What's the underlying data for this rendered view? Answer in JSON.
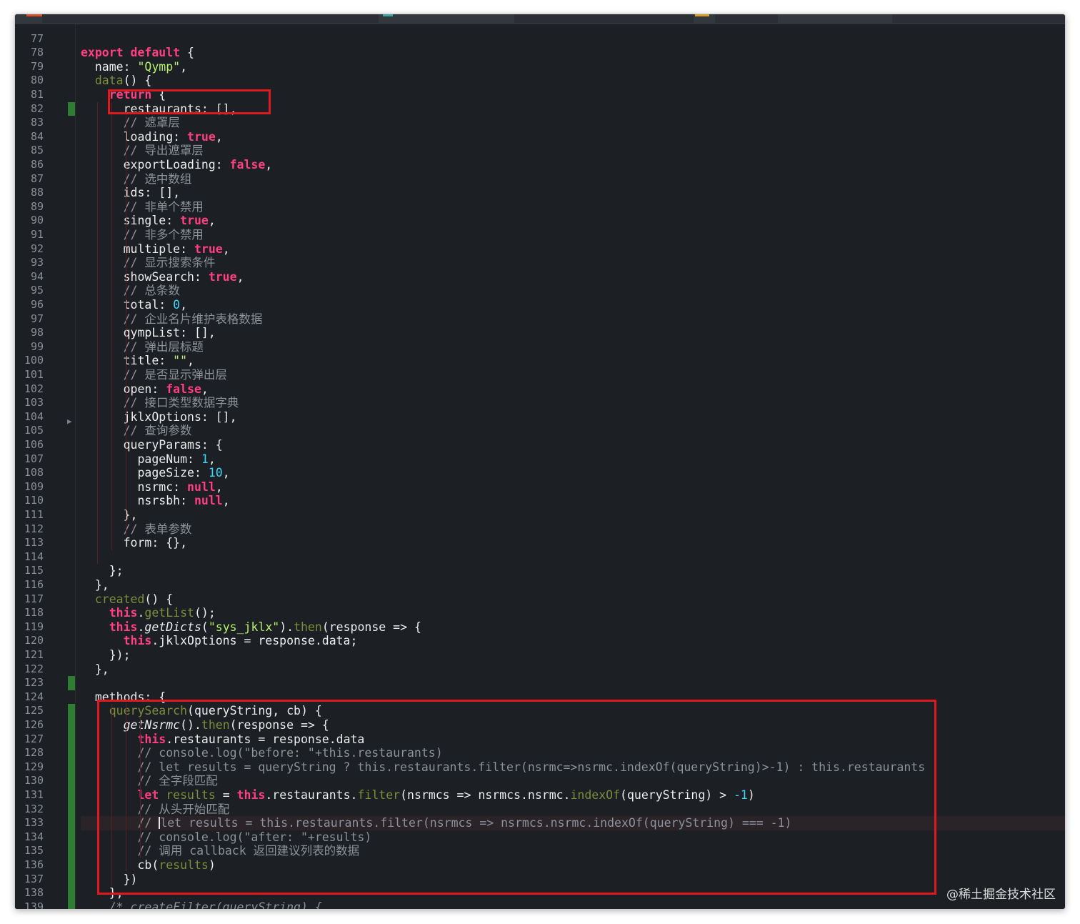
{
  "editor": {
    "line_numbers": [
      "77",
      "78",
      "79",
      "80",
      "81",
      "82",
      "83",
      "84",
      "85",
      "86",
      "87",
      "88",
      "89",
      "90",
      "91",
      "92",
      "93",
      "94",
      "95",
      "96",
      "97",
      "98",
      "99",
      "100",
      "101",
      "102",
      "103",
      "104",
      "105",
      "106",
      "107",
      "108",
      "109",
      "110",
      "111",
      "112",
      "113",
      "114",
      "115",
      "116",
      "117",
      "118",
      "119",
      "120",
      "121",
      "122",
      "123",
      "124",
      "125",
      "126",
      "127",
      "128",
      "129",
      "130",
      "131",
      "132",
      "133",
      "134",
      "135",
      "136",
      "137",
      "138",
      "139"
    ],
    "cursor_line": "133",
    "lines": [
      [],
      [
        {
          "t": "kw",
          "v": "export default"
        },
        {
          "t": "id",
          "v": " {"
        }
      ],
      [
        {
          "t": "id",
          "v": "  name: "
        },
        {
          "t": "str",
          "v": "\"Qymp\""
        },
        {
          "t": "id",
          "v": ","
        }
      ],
      [
        {
          "t": "fn",
          "v": "  data"
        },
        {
          "t": "id",
          "v": "() {"
        }
      ],
      [
        {
          "t": "kw",
          "v": "    return"
        },
        {
          "t": "id",
          "v": " {"
        }
      ],
      [
        {
          "t": "id",
          "v": "      restaurants: [],"
        }
      ],
      [
        {
          "t": "cmt",
          "v": "      // 遮罩层"
        }
      ],
      [
        {
          "t": "id",
          "v": "      loading: "
        },
        {
          "t": "kw",
          "v": "true"
        },
        {
          "t": "id",
          "v": ","
        }
      ],
      [
        {
          "t": "cmt",
          "v": "      // 导出遮罩层"
        }
      ],
      [
        {
          "t": "id",
          "v": "      exportLoading: "
        },
        {
          "t": "kw",
          "v": "false"
        },
        {
          "t": "id",
          "v": ","
        }
      ],
      [
        {
          "t": "cmt",
          "v": "      // 选中数组"
        }
      ],
      [
        {
          "t": "id",
          "v": "      ids: [],"
        }
      ],
      [
        {
          "t": "cmt",
          "v": "      // 非单个禁用"
        }
      ],
      [
        {
          "t": "id",
          "v": "      single: "
        },
        {
          "t": "kw",
          "v": "true"
        },
        {
          "t": "id",
          "v": ","
        }
      ],
      [
        {
          "t": "cmt",
          "v": "      // 非多个禁用"
        }
      ],
      [
        {
          "t": "id",
          "v": "      multiple: "
        },
        {
          "t": "kw",
          "v": "true"
        },
        {
          "t": "id",
          "v": ","
        }
      ],
      [
        {
          "t": "cmt",
          "v": "      // 显示搜索条件"
        }
      ],
      [
        {
          "t": "id",
          "v": "      showSearch: "
        },
        {
          "t": "kw",
          "v": "true"
        },
        {
          "t": "id",
          "v": ","
        }
      ],
      [
        {
          "t": "cmt",
          "v": "      // 总条数"
        }
      ],
      [
        {
          "t": "id",
          "v": "      total: "
        },
        {
          "t": "num",
          "v": "0"
        },
        {
          "t": "id",
          "v": ","
        }
      ],
      [
        {
          "t": "cmt",
          "v": "      // 企业名片维护表格数据"
        }
      ],
      [
        {
          "t": "id",
          "v": "      qympList: [],"
        }
      ],
      [
        {
          "t": "cmt",
          "v": "      // 弹出层标题"
        }
      ],
      [
        {
          "t": "id",
          "v": "      title: "
        },
        {
          "t": "str",
          "v": "\"\""
        },
        {
          "t": "id",
          "v": ","
        }
      ],
      [
        {
          "t": "cmt",
          "v": "      // 是否显示弹出层"
        }
      ],
      [
        {
          "t": "id",
          "v": "      open: "
        },
        {
          "t": "kw",
          "v": "false"
        },
        {
          "t": "id",
          "v": ","
        }
      ],
      [
        {
          "t": "cmt",
          "v": "      // 接口类型数据字典"
        }
      ],
      [
        {
          "t": "id",
          "v": "      jklxOptions: [],"
        }
      ],
      [
        {
          "t": "cmt",
          "v": "      // 查询参数"
        }
      ],
      [
        {
          "t": "id",
          "v": "      queryParams: {"
        }
      ],
      [
        {
          "t": "id",
          "v": "        pageNum: "
        },
        {
          "t": "num",
          "v": "1"
        },
        {
          "t": "id",
          "v": ","
        }
      ],
      [
        {
          "t": "id",
          "v": "        pageSize: "
        },
        {
          "t": "num",
          "v": "10"
        },
        {
          "t": "id",
          "v": ","
        }
      ],
      [
        {
          "t": "id",
          "v": "        nsrmc: "
        },
        {
          "t": "kw",
          "v": "null"
        },
        {
          "t": "id",
          "v": ","
        }
      ],
      [
        {
          "t": "id",
          "v": "        nsrsbh: "
        },
        {
          "t": "kw",
          "v": "null"
        },
        {
          "t": "id",
          "v": ","
        }
      ],
      [
        {
          "t": "id",
          "v": "      },"
        }
      ],
      [
        {
          "t": "cmt",
          "v": "      // 表单参数"
        }
      ],
      [
        {
          "t": "id",
          "v": "      form: {},"
        }
      ],
      [],
      [
        {
          "t": "id",
          "v": "    };"
        }
      ],
      [
        {
          "t": "id",
          "v": "  },"
        }
      ],
      [
        {
          "t": "fn",
          "v": "  created"
        },
        {
          "t": "id",
          "v": "() {"
        }
      ],
      [
        {
          "t": "kw",
          "v": "    this"
        },
        {
          "t": "id",
          "v": "."
        },
        {
          "t": "fn",
          "v": "getList"
        },
        {
          "t": "id",
          "v": "();"
        }
      ],
      [
        {
          "t": "kw",
          "v": "    this"
        },
        {
          "t": "id",
          "v": "."
        },
        {
          "t": "id it",
          "v": "getDicts"
        },
        {
          "t": "id",
          "v": "("
        },
        {
          "t": "str",
          "v": "\"sys_jklx\""
        },
        {
          "t": "id",
          "v": ")."
        },
        {
          "t": "fn",
          "v": "then"
        },
        {
          "t": "id",
          "v": "(response => {"
        }
      ],
      [
        {
          "t": "kw",
          "v": "      this"
        },
        {
          "t": "id",
          "v": ".jklxOptions = response.data;"
        }
      ],
      [
        {
          "t": "id",
          "v": "    });"
        }
      ],
      [
        {
          "t": "id",
          "v": "  },"
        }
      ],
      [],
      [
        {
          "t": "id",
          "v": "  methods: {"
        }
      ],
      [
        {
          "t": "fn",
          "v": "    querySearch"
        },
        {
          "t": "id",
          "v": "(queryString, cb) {"
        }
      ],
      [
        {
          "t": "id it",
          "v": "      getNsrmc"
        },
        {
          "t": "id",
          "v": "()."
        },
        {
          "t": "fn",
          "v": "then"
        },
        {
          "t": "id",
          "v": "(response => {"
        }
      ],
      [
        {
          "t": "kw",
          "v": "        this"
        },
        {
          "t": "id",
          "v": ".restaurants = response.data"
        }
      ],
      [
        {
          "t": "cmt",
          "v": "        // console.log(\"before: \"+this.restaurants)"
        }
      ],
      [
        {
          "t": "cmt",
          "v": "        // let results = queryString ? this.restaurants.filter(nsrmc=>nsrmc.indexOf(queryString)>-1) : this.restaurants"
        }
      ],
      [
        {
          "t": "cmt",
          "v": "        // 全字段匹配"
        }
      ],
      [
        {
          "t": "kw",
          "v": "        let"
        },
        {
          "t": "fn",
          "v": " results"
        },
        {
          "t": "id",
          "v": " = "
        },
        {
          "t": "kw",
          "v": "this"
        },
        {
          "t": "id",
          "v": ".restaurants."
        },
        {
          "t": "fn",
          "v": "filter"
        },
        {
          "t": "id",
          "v": "(nsrmcs => nsrmcs.nsrmc."
        },
        {
          "t": "fn",
          "v": "indexOf"
        },
        {
          "t": "id",
          "v": "(queryString) > "
        },
        {
          "t": "num",
          "v": "-1"
        },
        {
          "t": "id",
          "v": ")"
        }
      ],
      [
        {
          "t": "cmt",
          "v": "        // 从头开始匹配"
        }
      ],
      [
        {
          "t": "cmt",
          "v": "        // "
        },
        {
          "t": "cursor",
          "v": ""
        },
        {
          "t": "cmt",
          "v": "let results = this.restaurants.filter(nsrmcs => nsrmcs.nsrmc.indexOf(queryString) === -1)"
        }
      ],
      [
        {
          "t": "cmt",
          "v": "        // console.log(\"after: \"+results)"
        }
      ],
      [
        {
          "t": "cmt",
          "v": "        // 调用 callback 返回建议列表的数据"
        }
      ],
      [
        {
          "t": "id",
          "v": "        cb("
        },
        {
          "t": "fn",
          "v": "results"
        },
        {
          "t": "id",
          "v": ")"
        }
      ],
      [
        {
          "t": "id",
          "v": "      })"
        }
      ],
      [
        {
          "t": "id",
          "v": "    },"
        }
      ],
      [
        {
          "t": "cmt it",
          "v": "    /* createFilter(queryString) {"
        }
      ]
    ]
  },
  "colors": {
    "background": "#1c1f23",
    "keyword": "#ff3f7f",
    "string": "#b6f26a",
    "number": "#3ad6ff",
    "function": "#7d8d3a",
    "comment": "#8c9299",
    "highlight_box": "#e0191e"
  },
  "watermark": "@稀土掘金技术社区"
}
